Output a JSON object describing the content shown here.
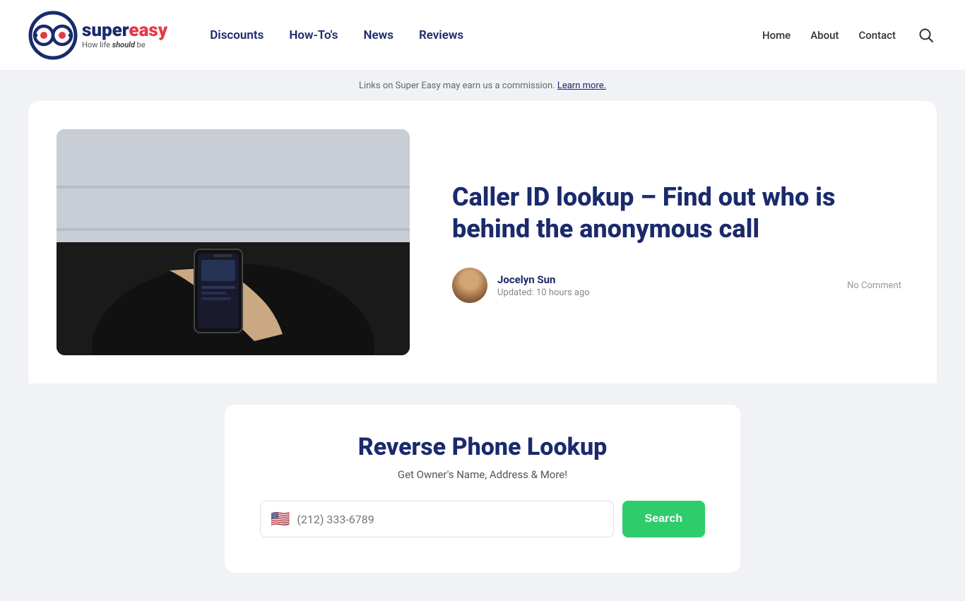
{
  "header": {
    "logo": {
      "super": "super",
      "easy": "easy",
      "tagline_prefix": "How life ",
      "tagline_bold": "should",
      "tagline_suffix": " be"
    },
    "nav": {
      "items": [
        {
          "label": "Discounts",
          "href": "#"
        },
        {
          "label": "How-To's",
          "href": "#"
        },
        {
          "label": "News",
          "href": "#"
        },
        {
          "label": "Reviews",
          "href": "#"
        }
      ]
    },
    "right_nav": {
      "items": [
        {
          "label": "Home",
          "href": "#"
        },
        {
          "label": "About",
          "href": "#"
        },
        {
          "label": "Contact",
          "href": "#"
        }
      ]
    }
  },
  "notice": {
    "text": "Links on Super Easy may earn us a commission.",
    "link_text": "Learn more."
  },
  "article": {
    "title": "Caller ID lookup – Find out who is behind the anonymous call",
    "author": {
      "name": "Jocelyn Sun",
      "updated": "Updated: 10 hours ago"
    },
    "comment_label": "No Comment"
  },
  "widget": {
    "title": "Reverse Phone Lookup",
    "subtitle": "Get Owner's Name, Address & More!",
    "phone_placeholder": "(212) 333-6789",
    "search_label": "Search",
    "flag": "🇺🇸"
  }
}
